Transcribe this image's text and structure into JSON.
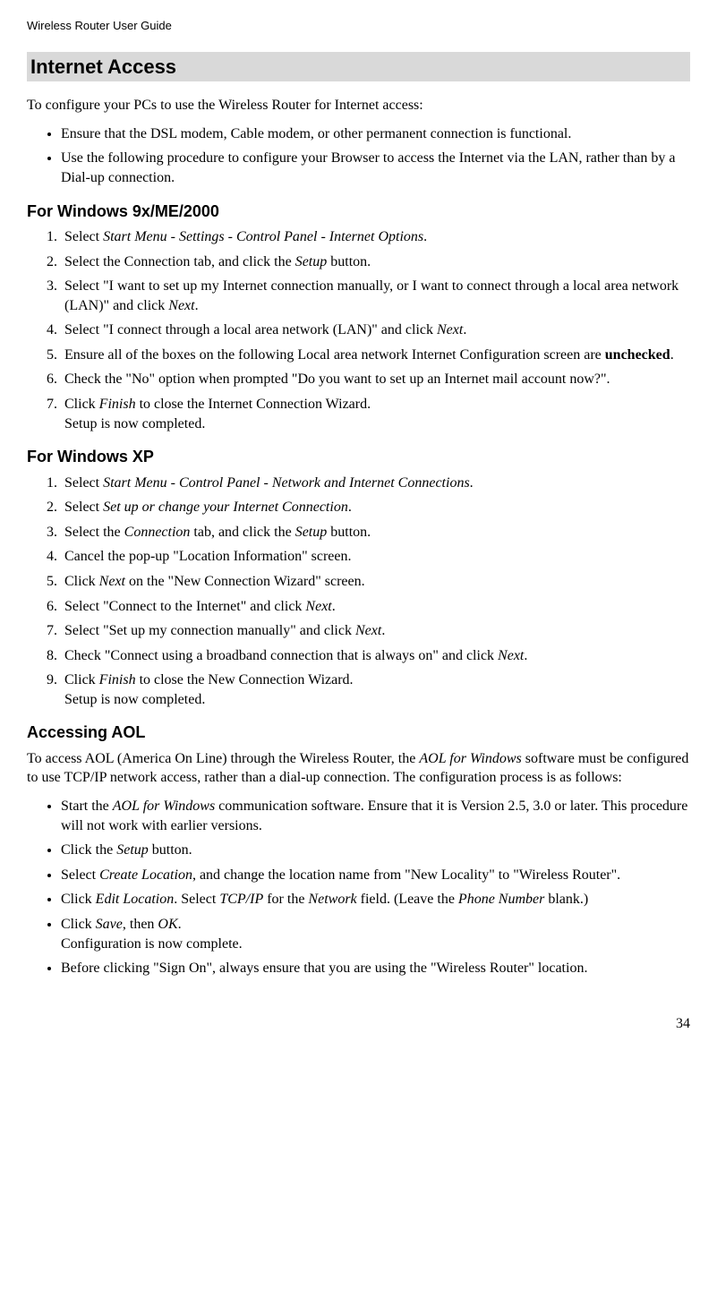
{
  "header": "Wireless Router User Guide",
  "sectionTitle": "Internet Access",
  "intro": "To configure your PCs to use the Wireless Router for Internet access:",
  "introBullets": [
    "Ensure that the DSL modem, Cable modem, or other permanent connection is functional.",
    "Use the following procedure to configure your Browser to access the Internet via the LAN, rather than by a Dial-up connection."
  ],
  "win9x": {
    "title": "For Windows 9x/ME/2000",
    "steps": [
      "Select <i>Start Menu - Settings - Control Panel - Internet Options</i>.",
      "Select the Connection tab, and click the <i>Setup</i> button.",
      "Select \"I want to set up my Internet connection manually, or I want to connect through a local area network (LAN)\" and click <i>Next</i>.",
      "Select \"I connect through a local area network (LAN)\" and click <i>Next</i>.",
      "Ensure all of the boxes on the following Local area network Internet Configuration screen are <b>unchecked</b>.",
      "Check the \"No\" option when prompted \"Do you want to set up an Internet mail account now?\".",
      "Click <i>Finish</i> to close the Internet Connection Wizard.<br>Setup is now completed."
    ]
  },
  "winxp": {
    "title": "For Windows XP",
    "steps": [
      "Select <i>Start Menu - Control Panel - Network and Internet Connections</i>.",
      "Select <i>Set up or change your Internet Connection</i>.",
      "Select the <i>Connection</i> tab, and click the <i>Setup</i> button.",
      "Cancel the pop-up \"Location Information\" screen.",
      "Click <i>Next</i> on the \"New Connection Wizard\" screen.",
      "Select \"Connect to the Internet\" and click <i>Next</i>.",
      "Select \"Set up my connection manually\" and click <i>Next</i>.",
      "Check \"Connect using a broadband connection that is always on\" and click <i>Next</i>.",
      "Click <i>Finish</i> to close the New Connection Wizard.<br>Setup is now completed."
    ]
  },
  "aol": {
    "title": "Accessing AOL",
    "intro": "To access AOL (America On Line) through the Wireless Router, the <i>AOL for Windows</i> software must be configured to use TCP/IP network access, rather than a dial-up connection. The configuration process is as follows:",
    "bullets": [
      "Start the <i>AOL for Windows</i> communication software. Ensure that it is Version 2.5, 3.0 or later. This procedure will not work with earlier versions.",
      "Click the <i>Setup</i> button.",
      "Select <i>Create Location</i>, and change the location name from \"New Locality\" to \"Wireless Router\".",
      "Click <i>Edit Location</i>. Select <i>TCP/IP</i> for the <i>Network</i> field. (Leave the <i>Phone Number</i> blank.)",
      "Click <i>Save</i>, then <i>OK</i>.<br>Configuration is now complete.",
      "Before clicking \"Sign On\", always ensure that you are using the \"Wireless Router\" location."
    ]
  },
  "pageNumber": "34"
}
